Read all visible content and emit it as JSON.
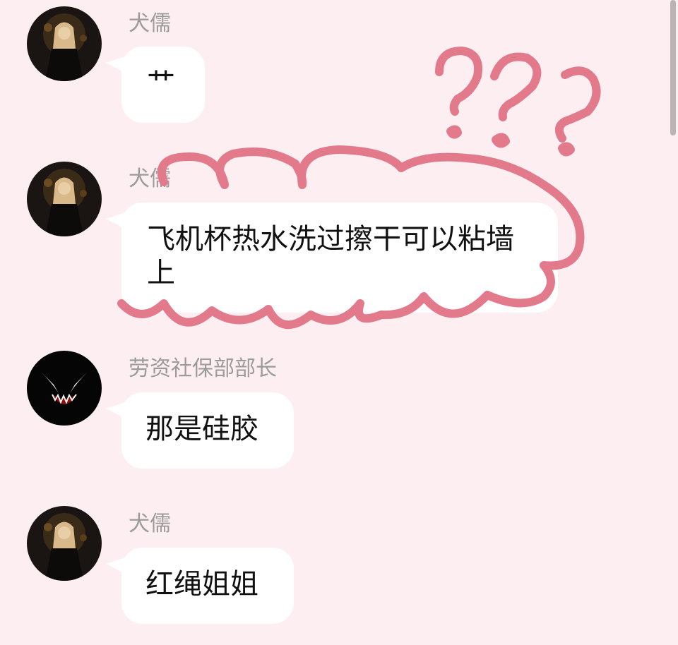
{
  "messages": [
    {
      "sender": "犬儒",
      "text": "艹",
      "avatar": "anime-girl-avatar"
    },
    {
      "sender": "犬儒",
      "text": "飞机杯热水洗过擦干可以粘墙上",
      "avatar": "anime-girl-avatar"
    },
    {
      "sender": "劳资社保部部长",
      "text": "那是硅胶",
      "avatar": "venom-avatar"
    },
    {
      "sender": "犬儒",
      "text": "红绳姐姐",
      "avatar": "anime-girl-avatar"
    }
  ],
  "annotation": {
    "color": "#e27a8c",
    "marks": "question-marks"
  },
  "colors": {
    "background": "#fdeef1",
    "bubble": "#ffffff",
    "sender_text": "#9b9b9b"
  }
}
